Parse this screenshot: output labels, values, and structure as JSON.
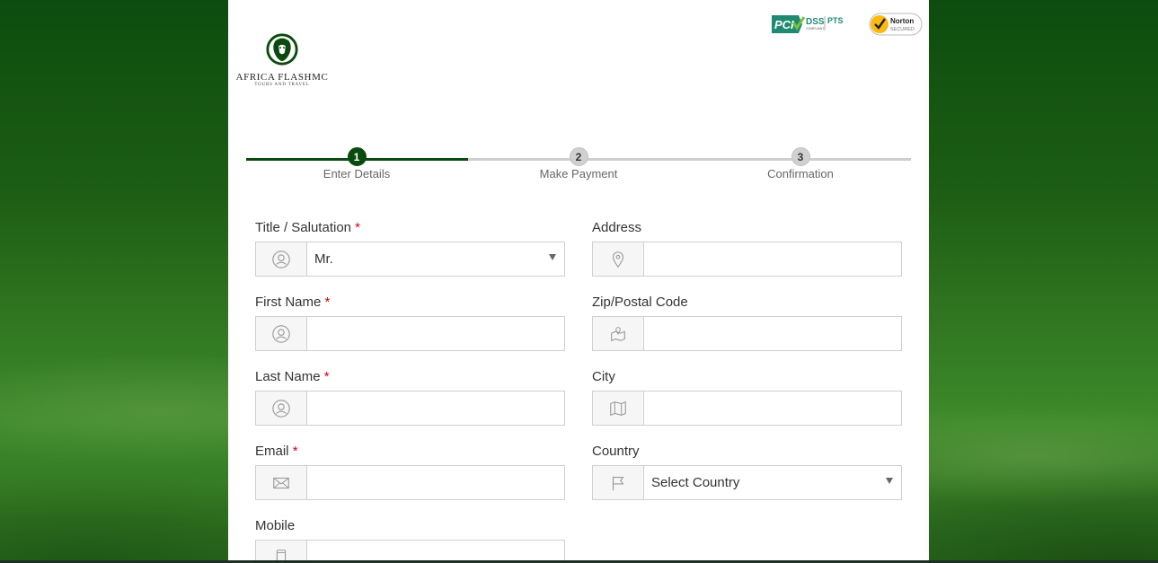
{
  "brand": {
    "name": "AFRICA FLASHMC",
    "tagline": "TOURS AND TRAVEL",
    "color": "#0b4a0e"
  },
  "badges": {
    "pci": {
      "text_main": "PCI",
      "text_dss": "DSS",
      "text_pts": "PTS",
      "sub": "COMPLIANT"
    },
    "norton": {
      "name": "Norton",
      "sub": "SECURED"
    }
  },
  "steps": [
    {
      "num": "1",
      "label": "Enter Details",
      "state": "active"
    },
    {
      "num": "2",
      "label": "Make Payment",
      "state": "todo"
    },
    {
      "num": "3",
      "label": "Confirmation",
      "state": "todo"
    }
  ],
  "form": {
    "title": {
      "label": "Title / Salutation",
      "required": "*",
      "value": "Mr.",
      "icon": "user-icon"
    },
    "first_name": {
      "label": "First Name",
      "required": "*",
      "value": "",
      "icon": "user-icon"
    },
    "last_name": {
      "label": "Last Name",
      "required": "*",
      "value": "",
      "icon": "user-icon"
    },
    "email": {
      "label": "Email",
      "required": "*",
      "value": "",
      "icon": "envelope-icon"
    },
    "mobile": {
      "label": "Mobile",
      "value": "",
      "icon": "mobile-phone-icon"
    },
    "address": {
      "label": "Address",
      "value": "",
      "icon": "map-pin-icon"
    },
    "zip": {
      "label": "Zip/Postal Code",
      "value": "",
      "icon": "map-marker-fold-icon"
    },
    "city": {
      "label": "City",
      "value": "",
      "icon": "map-icon"
    },
    "country": {
      "label": "Country",
      "value": "Select Country",
      "icon": "flag-icon"
    }
  }
}
